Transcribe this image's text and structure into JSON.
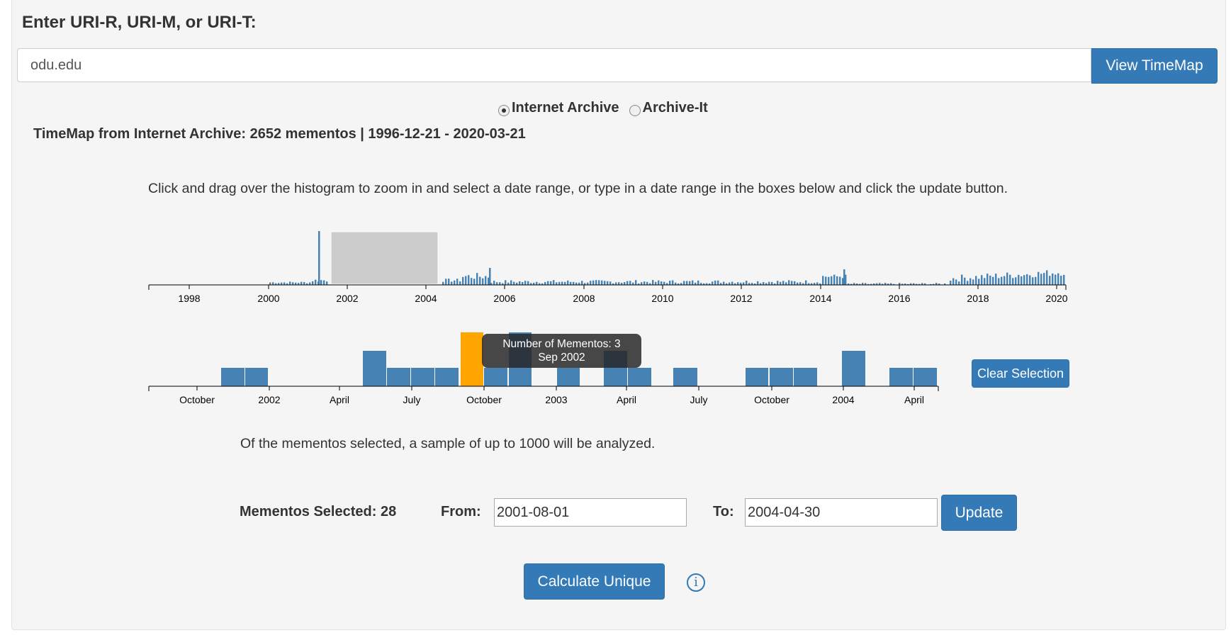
{
  "form": {
    "heading": "Enter URI-R, URI-M, or URI-T:",
    "uri_value": "odu.edu",
    "view_button": "View TimeMap",
    "archives": [
      {
        "label": "Internet Archive",
        "selected": true
      },
      {
        "label": "Archive-It",
        "selected": false
      }
    ]
  },
  "timemap": {
    "summary": "TimeMap from Internet Archive: 2652 mementos | 1996-12-21 - 2020-03-21",
    "instructions": "Click and drag over the histogram to zoom in and select a date range, or type in a date range in the boxes below and click the update button."
  },
  "overview_axis": {
    "ticks": [
      "1998",
      "2000",
      "2002",
      "2004",
      "2006",
      "2008",
      "2010",
      "2012",
      "2014",
      "2016",
      "2018",
      "2020"
    ]
  },
  "detail_axis": {
    "ticks": [
      "October",
      "2002",
      "April",
      "July",
      "October",
      "2003",
      "April",
      "July",
      "October",
      "2004",
      "April"
    ]
  },
  "tooltip": {
    "line1": "Number of Mementos: 3",
    "line2": "Sep 2002"
  },
  "colors": {
    "bar": "#4682b4",
    "highlight": "#ffa500",
    "brush": "#cccccc",
    "button": "#337ab7"
  },
  "clear_button": "Clear Selection",
  "sample_note": "Of the mementos selected, a sample of up to 1000 will be analyzed.",
  "selection": {
    "selected_label": "Mementos Selected: 28",
    "from_label": "From:",
    "from_value": "2001-08-01",
    "to_label": "To:",
    "to_value": "2004-04-30",
    "update_button": "Update"
  },
  "calculate_button": "Calculate Unique",
  "info_icon": "info-circle-icon"
}
